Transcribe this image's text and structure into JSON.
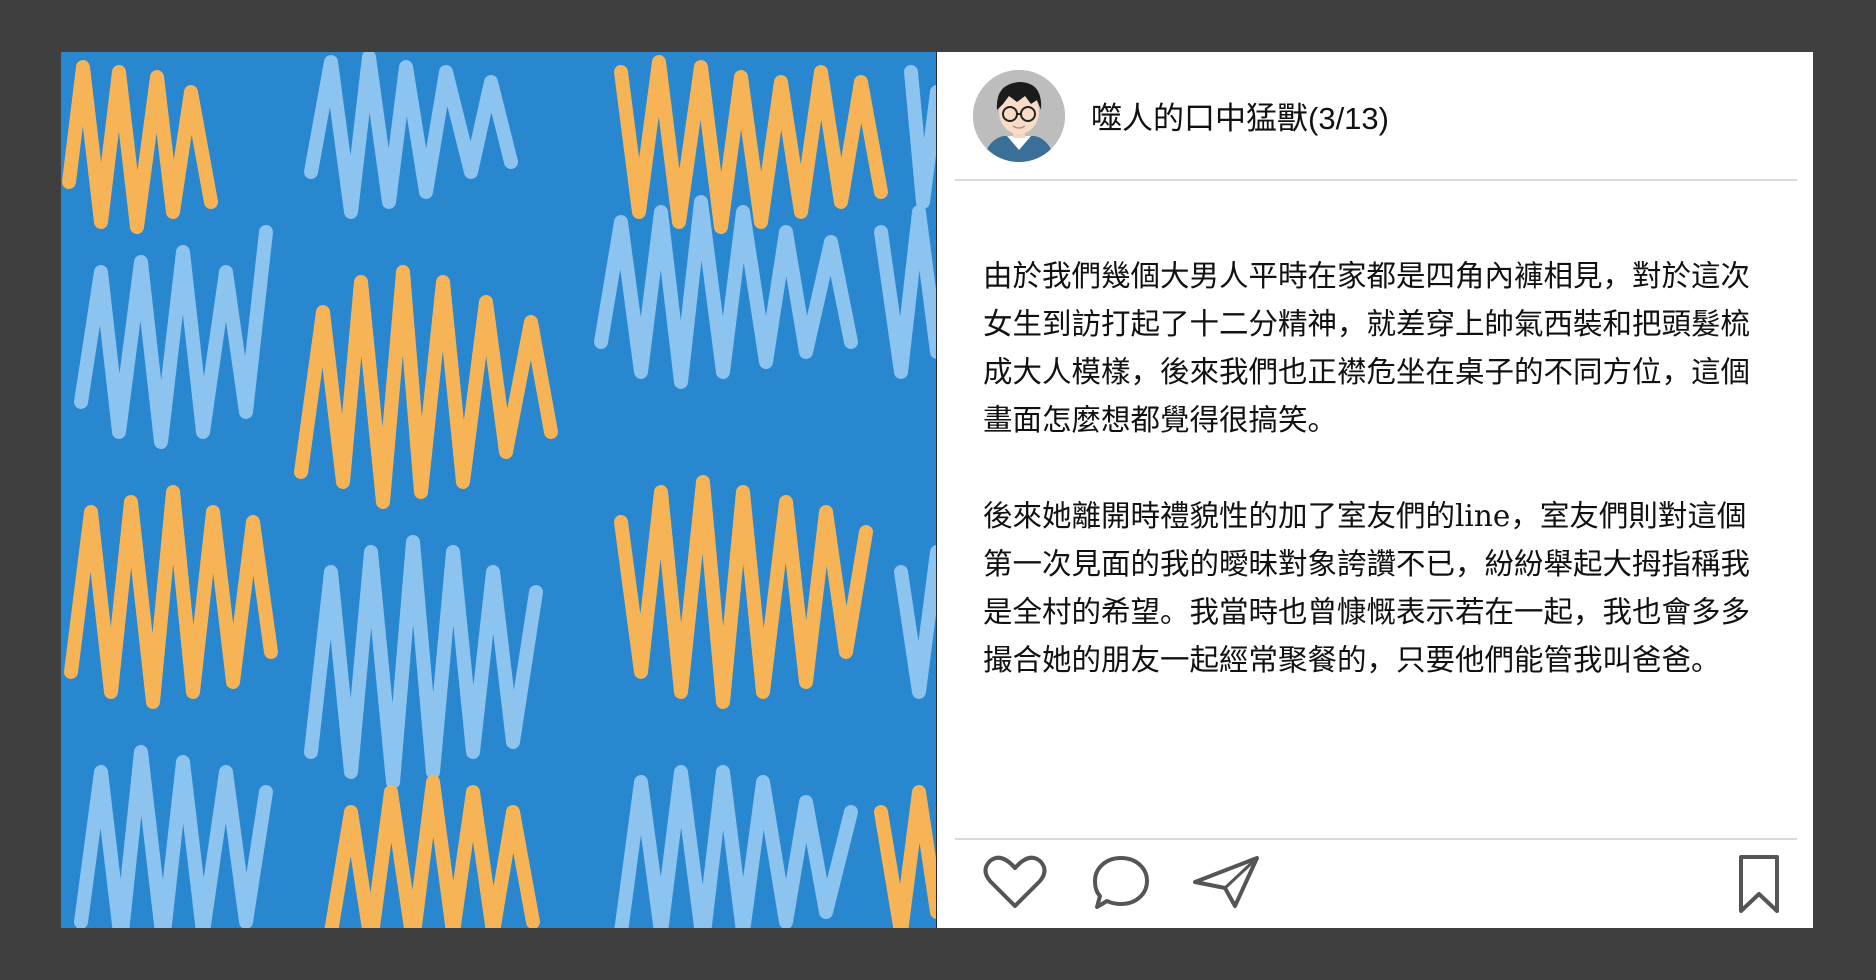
{
  "post": {
    "username": "噬人的口中猛獸(3/13)",
    "paragraphs": [
      "由於我們幾個大男人平時在家都是四角內褲相見，對於這次女生到訪打起了十二分精神，就差穿上帥氣西裝和把頭髮梳成大人模樣，後來我們也正襟危坐在桌子的不同方位，這個畫面怎麼想都覺得很搞笑。",
      "後來她離開時禮貌性的加了室友們的line，室友們則對這個第一次見面的我的曖昧對象誇讚不已，紛紛舉起大拇指稱我是全村的希望。我當時也曾慷慨表示若在一起，我也會多多撮合她的朋友一起經常聚餐的，只要他們能管我叫爸爸。"
    ]
  },
  "icons": {
    "avatar": "cartoon-boy-with-glasses-avatar",
    "like": "heart-icon",
    "comment": "speech-bubble-icon",
    "share": "paper-plane-icon",
    "save": "bookmark-icon"
  },
  "colors": {
    "background": "#3f3f3f",
    "art_blue": "#2987d0",
    "art_light_blue": "#8cc3ef",
    "art_orange": "#f6b456"
  }
}
